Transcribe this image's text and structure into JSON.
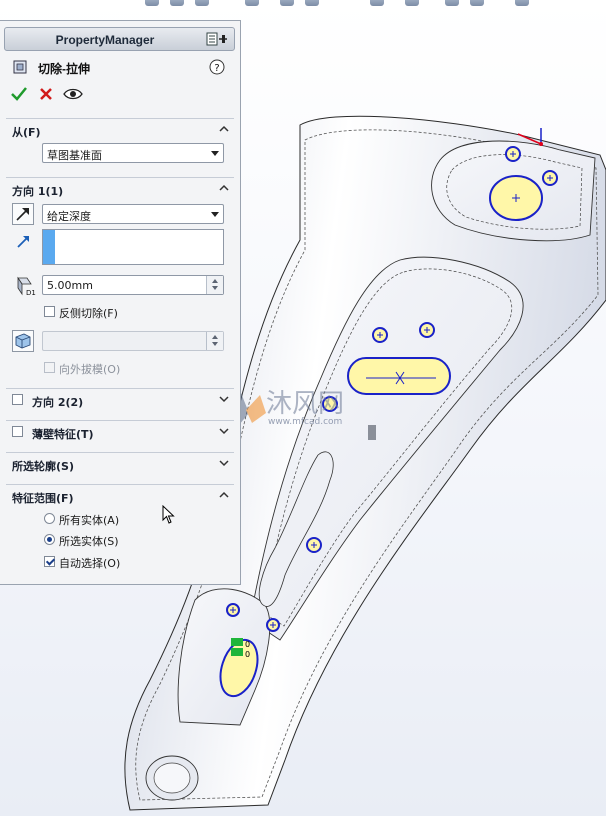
{
  "panel": {
    "title": "PropertyManager",
    "feature_name": "切除-拉伸",
    "actions": {
      "ok": "ok",
      "cancel": "cancel",
      "preview": "preview"
    },
    "from": {
      "label": "从(F)",
      "value": "草图基准面"
    },
    "direction1": {
      "label": "方向 1(1)",
      "end_condition": "给定深度",
      "depth": "5.00mm",
      "flip_side_cut_label": "反侧切除(F)",
      "flip_side_cut_checked": false,
      "draft_outward_label": "向外拔模(O)",
      "draft_outward_checked": false
    },
    "direction2": {
      "label": "方向 2(2)",
      "checked": false
    },
    "thin_feature": {
      "label": "薄壁特征(T)",
      "checked": false
    },
    "selected_contours": {
      "label": "所选轮廓(S)"
    },
    "feature_scope": {
      "label": "特征范围(F)",
      "options": [
        "所有实体(A)",
        "所选实体(S)"
      ],
      "selected": "所选实体(S)",
      "auto_select_label": "自动选择(O)",
      "auto_select_checked": true
    }
  },
  "viewport": {
    "watermark_text": "沐风网",
    "watermark_url": "www.mfcad.com",
    "model": "cut-extrude preview on part",
    "colors": {
      "sketch": "#1a22c8",
      "highlight": "#fff7a8",
      "origin": "#e0001b"
    }
  }
}
